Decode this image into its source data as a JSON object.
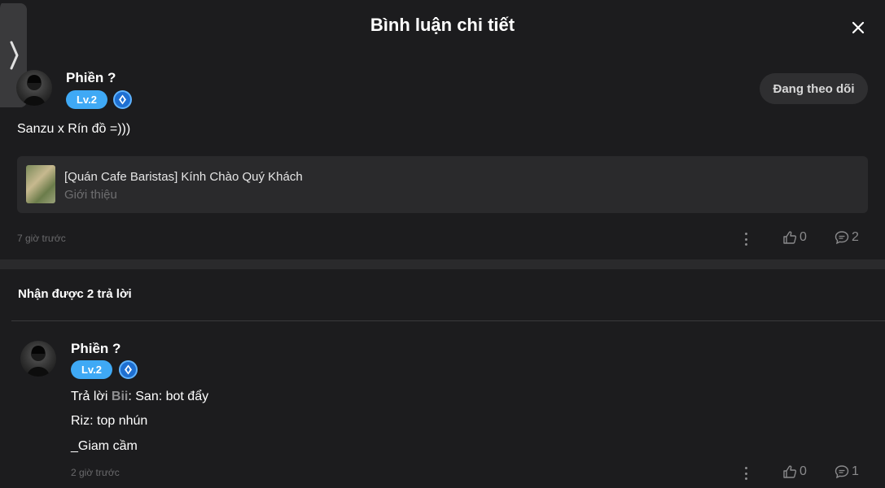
{
  "header": {
    "title": "Bình luận chi tiết"
  },
  "side_tab": {
    "icon": "chevron-right-icon"
  },
  "close_icon": "close-icon",
  "comment": {
    "username": "Phiền ?",
    "level": "Lv.2",
    "follow_label": "Đang theo dõi",
    "text": "Sanzu x Rín đồ =)))",
    "link_card": {
      "title": "[Quán Cafe Baristas] Kính Chào Quý Khách",
      "subtitle": "Giới thiệu"
    },
    "timestamp": "7 giờ trước",
    "likes": "0",
    "replies_count": "2"
  },
  "replies_section": {
    "title": "Nhận được 2 trả lời"
  },
  "reply": {
    "username": "Phiền ?",
    "level": "Lv.2",
    "prefix": "Trả lời ",
    "mention": "Bii",
    "line1_rest": ": San: bot đẩy",
    "line2": "Riz: top nhún",
    "line3": "_Giam cầm",
    "timestamp": "2 giờ trước",
    "likes": "0",
    "replies_count": "1"
  },
  "colors": {
    "accent": "#3fa9f5",
    "background": "#1c1c1e",
    "card": "#2a2a2c"
  }
}
